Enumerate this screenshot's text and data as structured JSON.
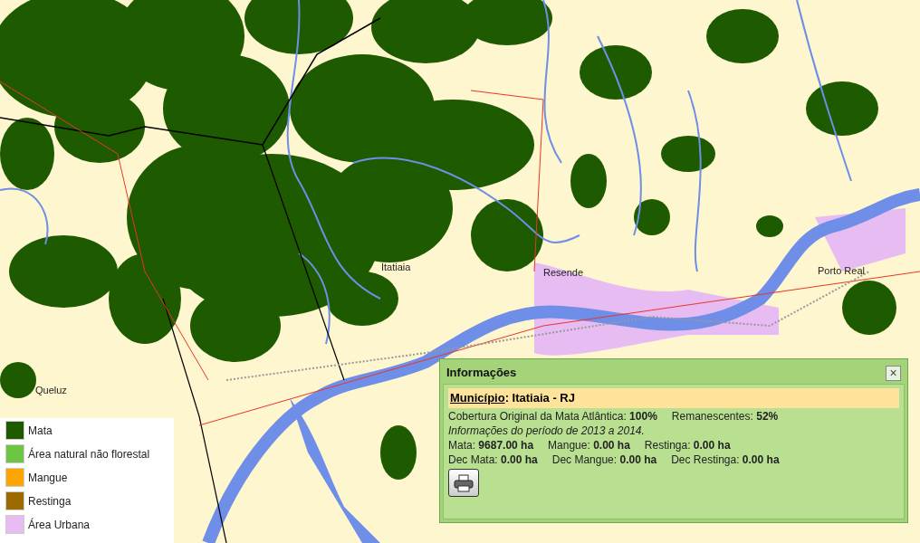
{
  "map": {
    "places": [
      "Itatiaia",
      "Resende",
      "Porto Real",
      "Queluz"
    ]
  },
  "legend": [
    {
      "label": "Mata",
      "color": "#1e5a00"
    },
    {
      "label": "Área natural não florestal",
      "color": "#6cc644"
    },
    {
      "label": "Mangue",
      "color": "#ffa500"
    },
    {
      "label": "Restinga",
      "color": "#9c6a00"
    },
    {
      "label": "Área Urbana",
      "color": "#e6bcf2"
    }
  ],
  "info": {
    "title": "Informações",
    "close": "×",
    "municipality_label": "Município",
    "municipality_value": ": Itatiaia - RJ",
    "coverage": [
      "Cobertura Original da Mata Atlântica: **100%**",
      "Remanescentes: **52%**"
    ],
    "period": "Informações do período de 2013 a 2014.",
    "stats": [
      [
        "Mata: **9687.00 ha**",
        "Mangue: **0.00 ha**",
        "Restinga: **0.00 ha**"
      ],
      [
        "Dec Mata: **0.00 ha**",
        "Dec Mangue: **0.00 ha**",
        "Dec Restinga: **0.00 ha**"
      ]
    ]
  }
}
